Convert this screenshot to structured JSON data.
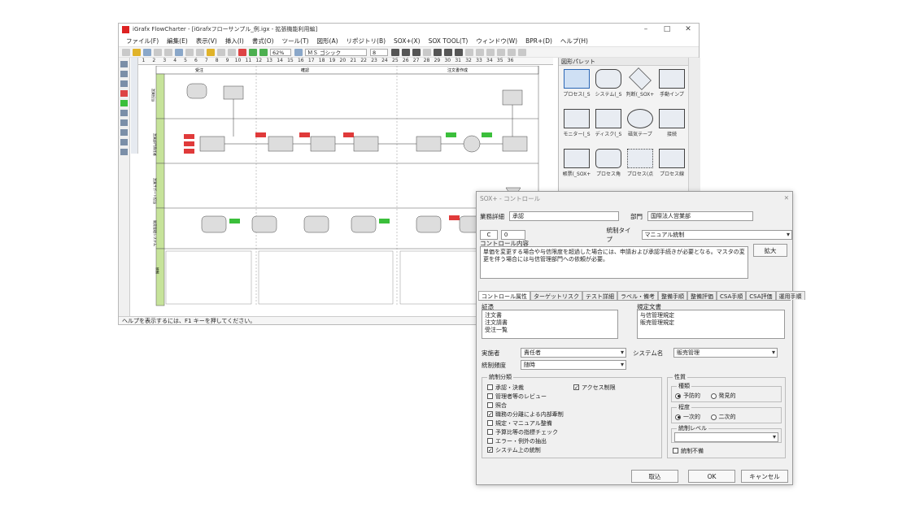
{
  "window": {
    "title": "iGrafx FlowCharter - [iGrafxフローサンプル_例.igx - 拡張機能利用編]"
  },
  "menu": [
    "ファイル(F)",
    "編集(E)",
    "表示(V)",
    "挿入(I)",
    "書式(O)",
    "ツール(T)",
    "図形(A)",
    "リポジトリ(B)",
    "SOX+(X)",
    "SOX TOOL(T)",
    "ウィンドウ(W)",
    "BPR+(D)",
    "ヘルプ(H)"
  ],
  "toolbar": {
    "zoom": "62%",
    "font": "ＭＳ ゴシック",
    "font_size": "8"
  },
  "ruler": [
    "1",
    "2",
    "3",
    "4",
    "5",
    "6",
    "7",
    "8",
    "9",
    "10",
    "11",
    "12",
    "13",
    "14",
    "15",
    "16",
    "17",
    "18",
    "19",
    "20",
    "21",
    "22",
    "23",
    "24",
    "25",
    "26",
    "27",
    "28",
    "29",
    "30",
    "31",
    "32",
    "33",
    "34",
    "35",
    "36"
  ],
  "flow": {
    "phases": [
      "受注",
      "確認",
      "注文書作成"
    ],
    "lanes": [
      "営業担当",
      "営業部門責任者",
      "営業サポート担当",
      "販売管理システム",
      "統制"
    ]
  },
  "status_text": "ヘルプを表示するには、F1 キーを押してください。",
  "palette": {
    "title": "図形パレット",
    "items": [
      "プロセス(_S",
      "システム(_S",
      "判断(_SOX+",
      "手動インプ",
      "モニター(_S",
      "ディスク(_S",
      "磁気テープ",
      "接続",
      "帳票(_SOX+",
      "プロセス角",
      "プロセス(点",
      "プロセス線"
    ]
  },
  "dialog": {
    "title": "SOX+ - コントロール",
    "business_detail_label": "業務詳細",
    "business_detail_value": "承認",
    "dept_label": "部門",
    "dept_value": "国際法人営業部",
    "c_label": "C",
    "c_value": "0",
    "control_type_label": "統制タイプ",
    "control_type_value": "マニュアル統制",
    "content_label": "コントロール内容",
    "content_text": "単価を変更する場合や与信限度を超過した場合には、申請および承認手続きが必要となる。マスタの変更を伴う場合には与信管理部門への依頼が必要。",
    "expand_button": "拡大",
    "tabs": [
      "コントロール属性",
      "ターゲットリスク",
      "テスト詳細",
      "ラベル・備考",
      "整備手順",
      "整備評価",
      "CSA手順",
      "CSA評価",
      "運用手順"
    ],
    "evidence_label": "証憑",
    "evidence_items": [
      "注文書",
      "注文請書",
      "受注一覧"
    ],
    "rules_label": "規定文書",
    "rules_items": [
      "与信管理規定",
      "販売管理規定"
    ],
    "executor_label": "実施者",
    "executor_value": "責任者",
    "system_label": "システム名",
    "system_value": "販売管理",
    "frequency_label": "統制頻度",
    "frequency_value": "随時",
    "classification_label": "統制分類",
    "classifications": [
      {
        "label": "承認・決裁",
        "checked": false
      },
      {
        "label": "管理者等のレビュー",
        "checked": false
      },
      {
        "label": "照合",
        "checked": false
      },
      {
        "label": "職務の分離による内部牽制",
        "checked": true
      },
      {
        "label": "規定・マニュアル整備",
        "checked": false
      },
      {
        "label": "予算比等の指標チェック",
        "checked": false
      },
      {
        "label": "エラー・例外の抽出",
        "checked": false
      },
      {
        "label": "システム上の統制",
        "checked": true
      }
    ],
    "access_restriction": {
      "label": "アクセス制限",
      "checked": true
    },
    "nature_label": "性質",
    "kind_label": "種類",
    "kind_options": [
      "予防的",
      "発見的"
    ],
    "kind_selected": "予防的",
    "degree_label": "程度",
    "degree_options": [
      "一次的",
      "二次的"
    ],
    "degree_selected": "一次的",
    "level_label": "統制レベル",
    "level_value": "",
    "unnecessary_label": "統制不備",
    "cancel_button": "取込",
    "ok_button": "OK",
    "close_button": "キャンセル"
  },
  "colors": {
    "lane_header": "#f0d64a",
    "lane_band": "#c6e39a",
    "red_tag": "#e03a3a",
    "green_tag": "#3bbf3b"
  }
}
